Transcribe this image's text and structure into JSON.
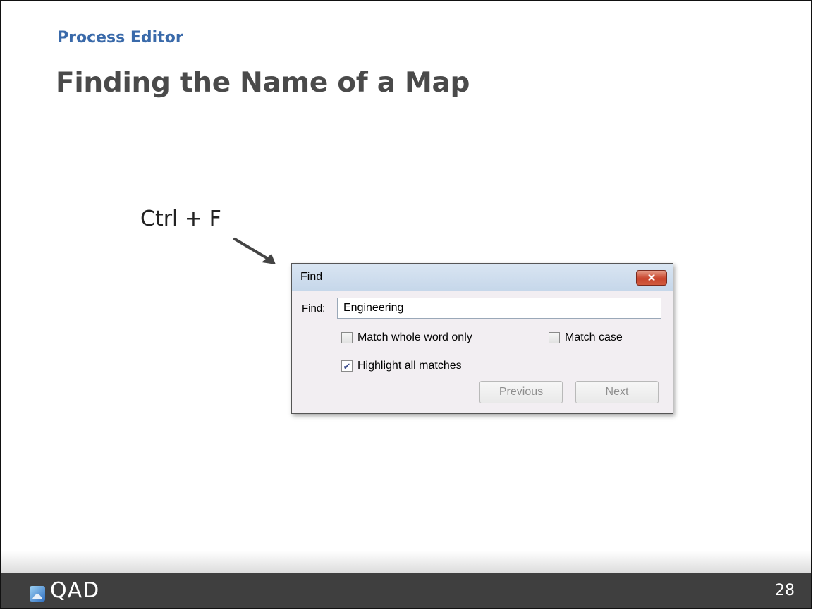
{
  "slide": {
    "subtitle": "Process Editor",
    "title": "Finding the Name of a Map",
    "shortcut": "Ctrl + F"
  },
  "find_dialog": {
    "title": "Find",
    "close_label": "✕",
    "find_label": "Find:",
    "find_value": "Engineering",
    "options": {
      "match_whole_word": {
        "label": "Match whole word only",
        "checked": false
      },
      "match_case": {
        "label": "Match case",
        "checked": false
      },
      "highlight_all": {
        "label": "Highlight all matches",
        "checked": true
      }
    },
    "buttons": {
      "previous": "Previous",
      "next": "Next"
    }
  },
  "footer": {
    "logo_text": "QAD",
    "page_number": "28"
  },
  "colors": {
    "subtitle": "#3a6aaa",
    "title": "#4a4a4a",
    "footer_bg": "#3f3f3f"
  }
}
